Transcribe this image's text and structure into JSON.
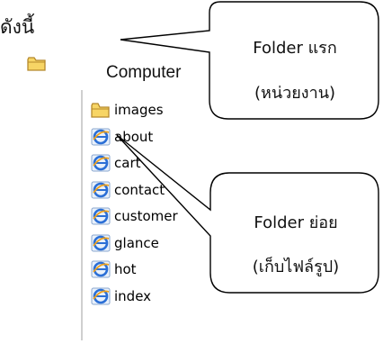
{
  "heading": "ดังนี้",
  "root": {
    "label": "Computer",
    "icon": "folder-icon"
  },
  "tree": {
    "items": [
      {
        "label": "images",
        "icon": "folder-icon"
      },
      {
        "label": "about",
        "icon": "ie-page-icon"
      },
      {
        "label": "cart",
        "icon": "ie-page-icon"
      },
      {
        "label": "contact",
        "icon": "ie-page-icon"
      },
      {
        "label": "customer",
        "icon": "ie-page-icon"
      },
      {
        "label": "glance",
        "icon": "ie-page-icon"
      },
      {
        "label": "hot",
        "icon": "ie-page-icon"
      },
      {
        "label": "index",
        "icon": "ie-page-icon"
      }
    ]
  },
  "callouts": {
    "first": {
      "line1": "Folder แรก",
      "line2": "(หน่วยงาน)"
    },
    "sub": {
      "line1": "Folder ย่อย",
      "line2": "(เก็บไฟล์รูป)"
    }
  },
  "colors": {
    "folder_fill": "#f7d565",
    "folder_stroke": "#b5892c",
    "ie_blue": "#2b6fd6",
    "ie_orange": "#f0a21b",
    "callout_stroke": "#000000"
  }
}
